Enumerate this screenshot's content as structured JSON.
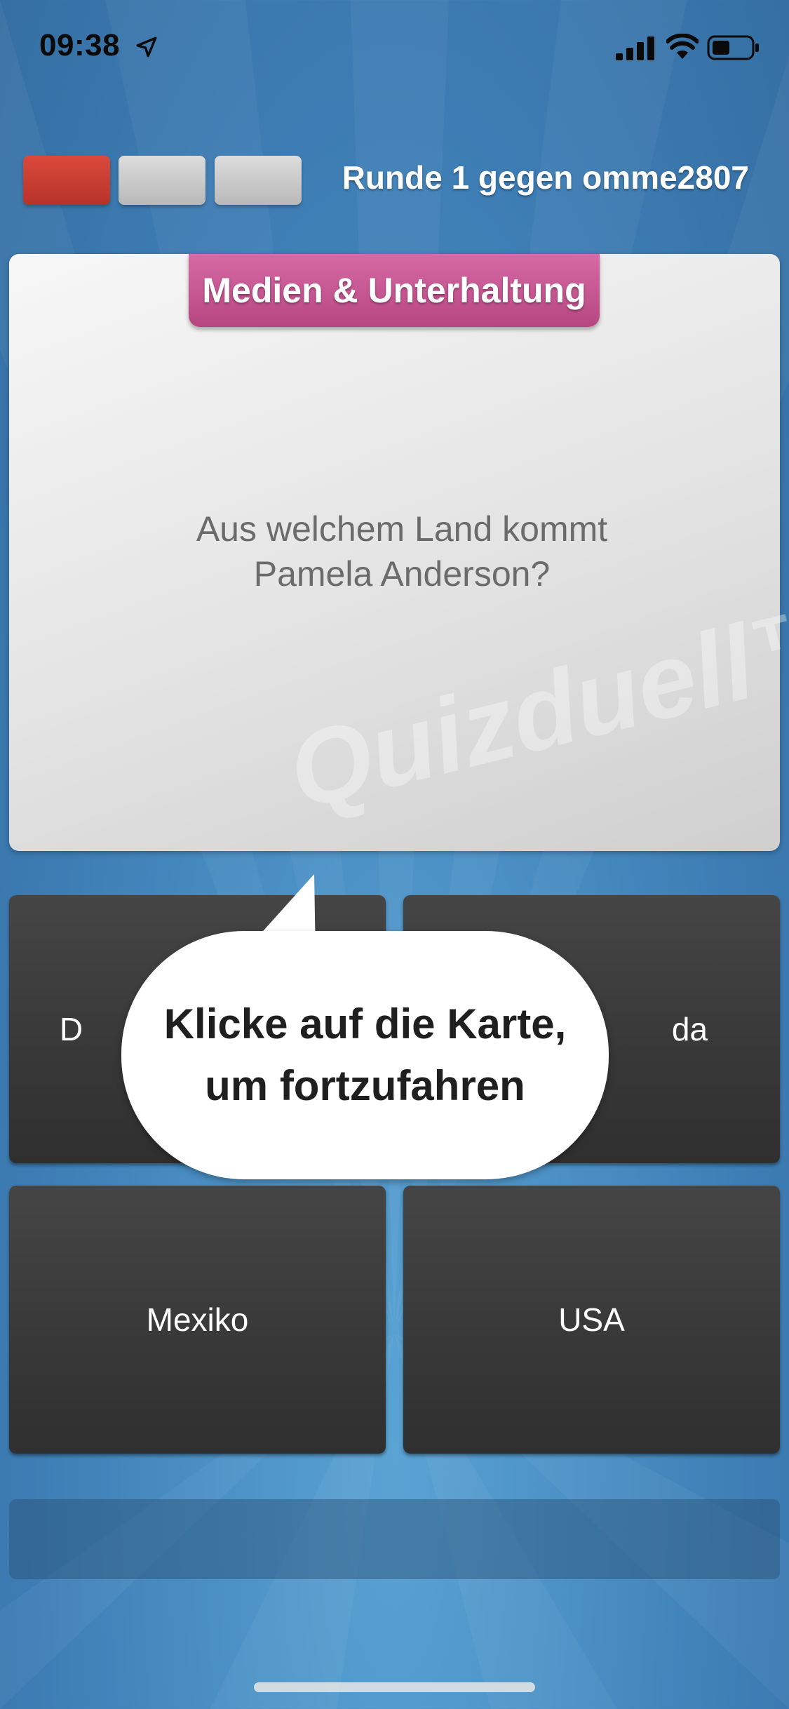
{
  "status_bar": {
    "time": "09:38",
    "icons": [
      "location-arrow-icon",
      "signal-icon",
      "wifi-icon",
      "battery-icon"
    ]
  },
  "header": {
    "round_title": "Runde 1 gegen omme2807",
    "round_indicators": [
      "red",
      "gray",
      "gray"
    ]
  },
  "question_card": {
    "category": "Medien & Unterhaltung",
    "question_line1": "Aus welchem Land kommt",
    "question_line2": "Pamela Anderson?",
    "watermark": "Quizduell™"
  },
  "answers": [
    {
      "label": "D"
    },
    {
      "label": "da"
    },
    {
      "label": "Mexiko"
    },
    {
      "label": "USA"
    }
  ],
  "hint": {
    "line1": "Klicke auf die Karte,",
    "line2": "um fortzufahren"
  },
  "colors": {
    "background": "#4a8fc4",
    "category_tab": "#c5588f",
    "round_red": "#c93b30",
    "round_gray": "#c8c8c8",
    "answer_button": "#3a3a3a"
  }
}
